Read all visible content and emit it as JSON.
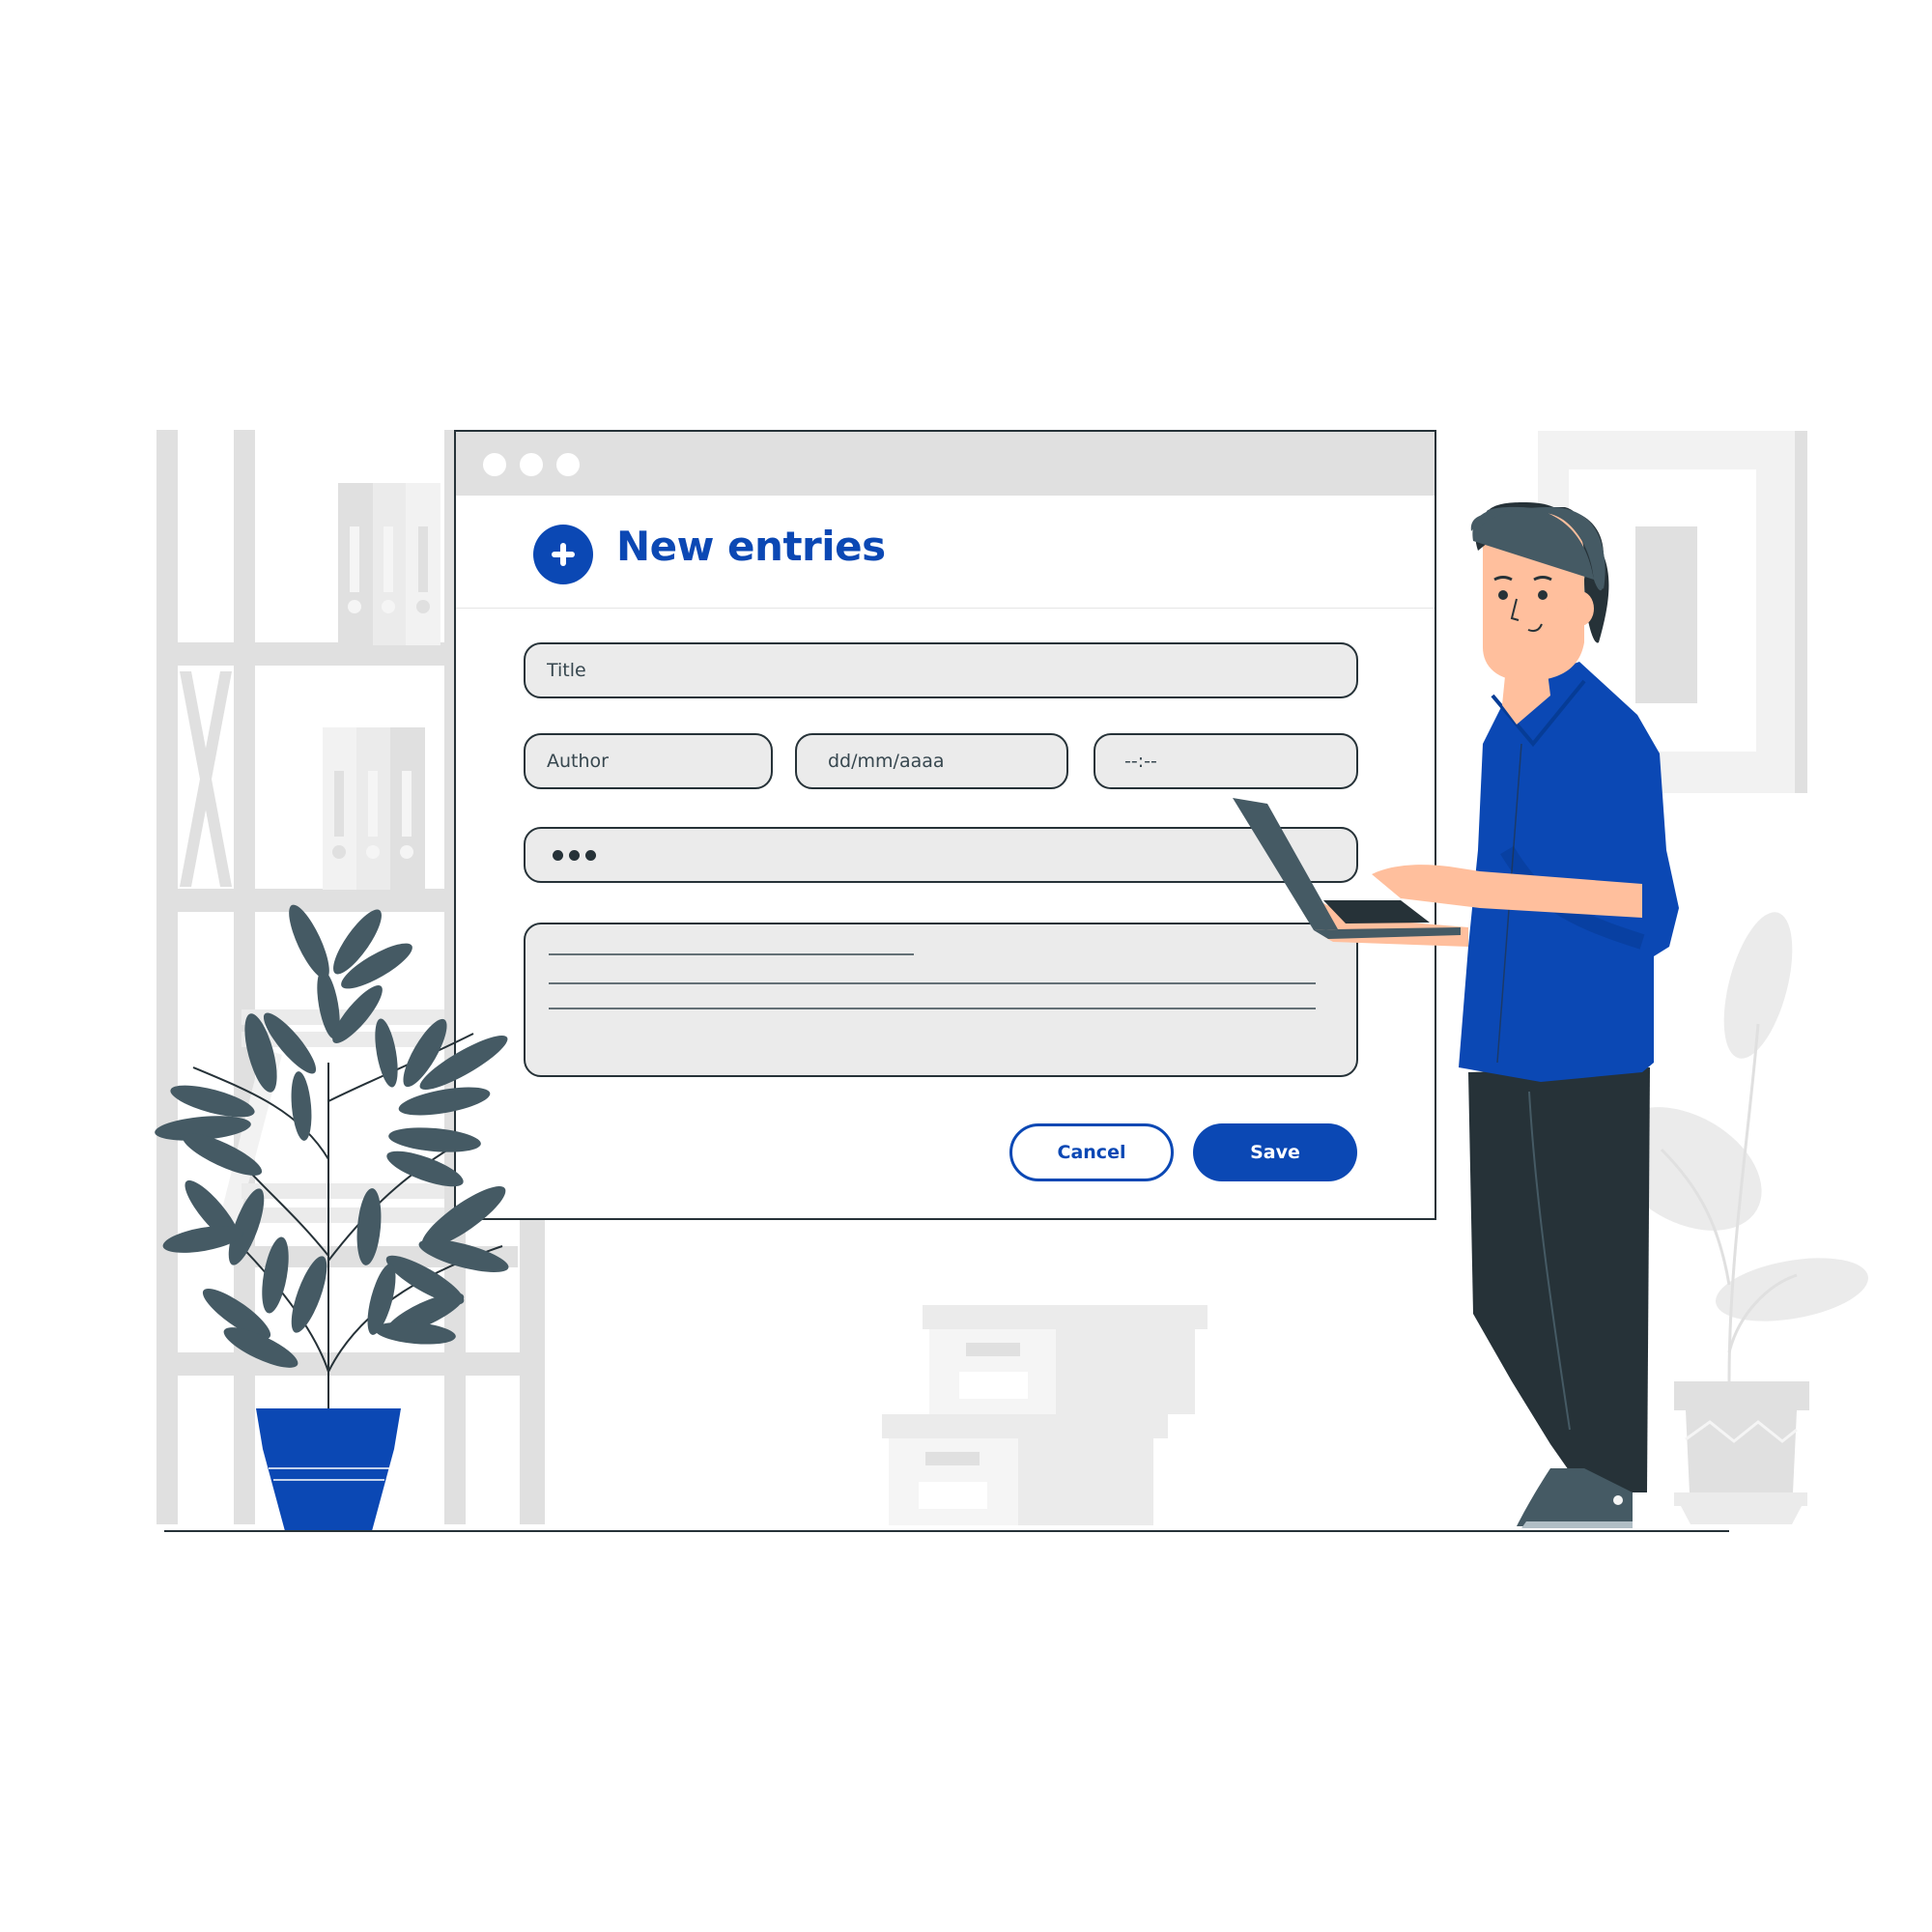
{
  "window": {
    "controls": [
      "dot",
      "dot",
      "dot"
    ]
  },
  "header": {
    "title": "New entries",
    "add_icon": "plus-circle-icon"
  },
  "form": {
    "title_field": {
      "placeholder": "Title",
      "value": ""
    },
    "author_field": {
      "placeholder": "Author",
      "value": ""
    },
    "date_field": {
      "placeholder": "dd/mm/aaaa",
      "value": ""
    },
    "time_field": {
      "placeholder": "--:--",
      "value": ""
    },
    "password_field": {
      "masked_length": 3
    },
    "description_field": {
      "placeholder": "",
      "value": ""
    }
  },
  "actions": {
    "cancel_label": "Cancel",
    "save_label": "Save"
  },
  "colors": {
    "accent": "#0b48b4",
    "dark": "#263238",
    "field_bg": "#ebebeb",
    "background_props": "#e0e0e0",
    "leaf": "#455a64",
    "skin": "#ffbf9d"
  }
}
